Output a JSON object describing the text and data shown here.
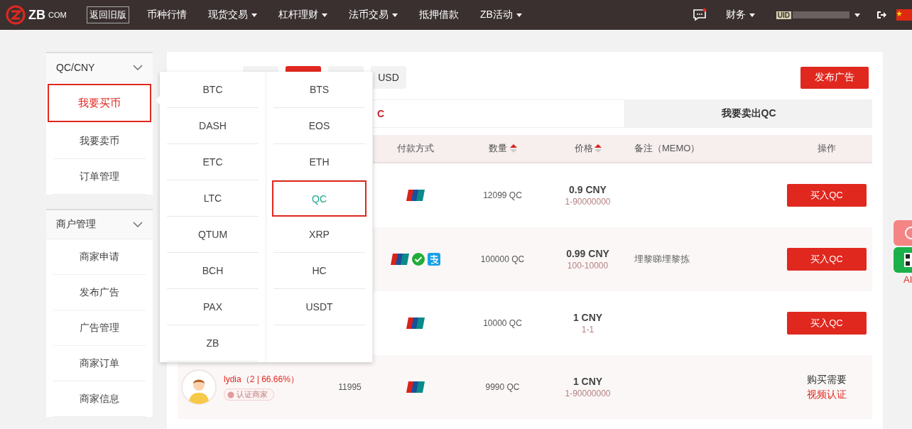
{
  "navbar": {
    "logo": {
      "mark": "ZB",
      "suffix": "COM"
    },
    "old_version": "返回旧版",
    "menu": [
      {
        "label": "币种行情",
        "dropdown": false
      },
      {
        "label": "现货交易",
        "dropdown": true
      },
      {
        "label": "杠杆理财",
        "dropdown": true
      },
      {
        "label": "法币交易",
        "dropdown": true
      },
      {
        "label": "抵押借款",
        "dropdown": false
      },
      {
        "label": "ZB活动",
        "dropdown": true
      }
    ],
    "message_unread": true,
    "finance": "财务",
    "user": "UID"
  },
  "sidebar": [
    {
      "title": "QC/CNY",
      "expanded": true,
      "items": [
        {
          "label": "我要买币",
          "selected": true
        },
        {
          "label": "我要卖币",
          "selected": false
        },
        {
          "label": "订单管理",
          "selected": false
        }
      ]
    },
    {
      "title": "商户管理",
      "expanded": true,
      "items": [
        {
          "label": "商家申请",
          "selected": false
        },
        {
          "label": "发布广告",
          "selected": false
        },
        {
          "label": "广告管理",
          "selected": false
        },
        {
          "label": "商家订单",
          "selected": false
        },
        {
          "label": "商家信息",
          "selected": false
        }
      ]
    }
  ],
  "currency_tabs": [
    {
      "selected": false
    },
    {
      "selected": true
    },
    {
      "selected": false
    },
    {
      "label": "USD",
      "selected": false
    }
  ],
  "publish_button": "发布广告",
  "trade_tabs": [
    {
      "label": "C",
      "selected": true
    },
    {
      "label": "我要卖出QC",
      "selected": false
    }
  ],
  "table": {
    "columns": [
      {},
      {},
      {
        "label": "付款方式",
        "sortable": false
      },
      {
        "label": "数量",
        "sortable": true
      },
      {
        "label": "价格",
        "sortable": true
      },
      {
        "label": "备注（MEMO）",
        "sortable": false
      },
      {
        "label": "操作",
        "sortable": false
      }
    ],
    "rows": [
      {
        "payments": [
          {
            "kind": "unionpay"
          }
        ],
        "quantity": "12099 QC",
        "price": "0.9 CNY",
        "limit": "1-90000000",
        "action": {
          "kind": "button",
          "label": "买入QC"
        }
      },
      {
        "payments": [
          {
            "kind": "unionpay"
          },
          {
            "kind": "wechat"
          },
          {
            "kind": "alipay"
          }
        ],
        "quantity": "100000 QC",
        "price": "0.99 CNY",
        "limit": "100-10000",
        "memo": "埋黎睇埋黎拣",
        "action": {
          "kind": "button",
          "label": "买入QC"
        }
      },
      {
        "payments": [
          {
            "kind": "unionpay"
          }
        ],
        "quantity": "10000 QC",
        "price": "1 CNY",
        "limit": "1-1",
        "action": {
          "kind": "button",
          "label": "买入QC"
        }
      },
      {
        "merchant": {
          "name": "lydia（2 | 66.66%）",
          "badge": "认证商家"
        },
        "count": "11995",
        "payments": [
          {
            "kind": "unionpay"
          }
        ],
        "quantity": "9990 QC",
        "price": "1 CNY",
        "limit": "1-90000000",
        "action": {
          "kind": "notice",
          "label": "购买需要",
          "link": "视频认证"
        }
      }
    ]
  },
  "coin_dropdown": {
    "columns": [
      [
        {
          "label": "BTC",
          "selected": false
        },
        {
          "label": "DASH",
          "selected": false
        },
        {
          "label": "ETC",
          "selected": false
        },
        {
          "label": "LTC",
          "selected": false
        },
        {
          "label": "QTUM",
          "selected": false
        },
        {
          "label": "BCH",
          "selected": false
        },
        {
          "label": "PAX",
          "selected": false
        },
        {
          "label": "ZB",
          "selected": false
        }
      ],
      [
        {
          "label": "BTS",
          "selected": false
        },
        {
          "label": "EOS",
          "selected": false
        },
        {
          "label": "ETH",
          "selected": false
        },
        {
          "label": "QC",
          "selected": true
        },
        {
          "label": "XRP",
          "selected": false
        },
        {
          "label": "HC",
          "selected": false
        },
        {
          "label": "USDT",
          "selected": false
        }
      ]
    ]
  },
  "side_float": {
    "label": "AI"
  }
}
